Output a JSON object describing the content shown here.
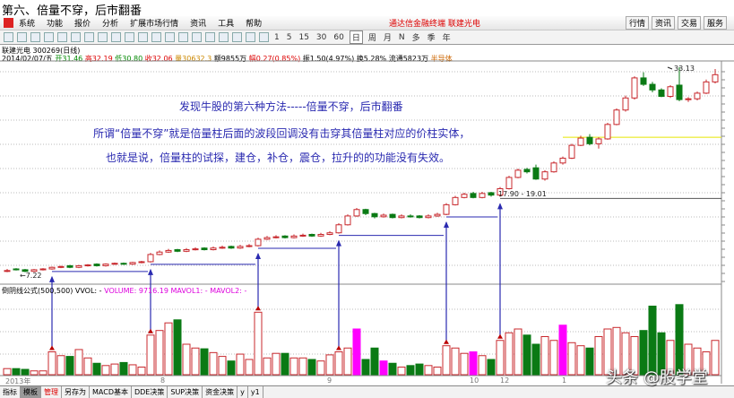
{
  "page_title": "第六、倍量不穿，后市翻番",
  "menu": [
    "系统",
    "功能",
    "报价",
    "分析",
    "扩展市场行情",
    "资讯",
    "工具",
    "帮助"
  ],
  "promo": "通达信金融终端   联建光电",
  "right_buttons": [
    "行情",
    "资讯",
    "交易",
    "服务"
  ],
  "periods": [
    "1",
    "5",
    "15",
    "30",
    "60",
    "日",
    "周",
    "月",
    "N",
    "多",
    "季",
    "年"
  ],
  "stock_title": "联建光电 300269(日线)",
  "quote": {
    "date": "2014/02/07/五",
    "open": "开31.46",
    "high": "高32.19",
    "low": "低30.80",
    "close": "收32.06",
    "vol": "量30632.3",
    "amount": "额9855万",
    "change": "幅0.27(0.85%)",
    "amp": "振1.50(4.97%)",
    "turnover": "换5.28%",
    "float": "流通5823万",
    "sector": "半导体"
  },
  "notes": [
    "发现牛股的第六种方法-----倍量不穿，后市翻番",
    "所谓“倍量不穿”就是倍量柱后面的波段回调没有击穿其倍量柱对应的价柱实体，",
    "也就是说，倍量柱的试探，建仓，补仓，震仓，拉升的的功能没有失效。"
  ],
  "labels": {
    "low": "7.22",
    "high": "33.13",
    "range": "17.90 - 19.01"
  },
  "vol_header": {
    "name": "倒阴线公式(500,500) VVOL: -",
    "volume": "VOLUME: 9716.19",
    "ma": "MAVOL1: - MAVOL2: -"
  },
  "dates": [
    "2013年",
    "8",
    "9",
    "10",
    "12",
    "1"
  ],
  "bottom_tabs": [
    "指标",
    "模板",
    "管理",
    "另存为",
    "MACD基本",
    "DDE决策",
    "SUP决策",
    "资金决策",
    "y",
    "y1"
  ],
  "watermark": "头条 @股学堂",
  "colors": {
    "up": "#c8282d",
    "down": "#0a7a14",
    "special": "#ff00ff",
    "arrow": "#2a2ab0",
    "support": "#e8e800"
  },
  "chart_data": {
    "type": "candlestick",
    "price_range": [
      7.22,
      33.13
    ],
    "ohlc": [
      [
        7.7,
        8.0,
        7.6,
        7.8
      ],
      [
        8.0,
        8.1,
        7.8,
        7.9
      ],
      [
        7.9,
        8.0,
        7.6,
        7.7
      ],
      [
        7.7,
        8.0,
        7.6,
        7.9
      ],
      [
        7.9,
        8.1,
        7.8,
        8.0
      ],
      [
        8.0,
        8.3,
        7.9,
        8.2
      ],
      [
        8.2,
        8.4,
        8.1,
        8.3
      ],
      [
        8.4,
        8.5,
        8.1,
        8.2
      ],
      [
        8.2,
        8.5,
        8.1,
        8.4
      ],
      [
        8.4,
        8.6,
        8.3,
        8.5
      ],
      [
        8.6,
        8.7,
        8.3,
        8.4
      ],
      [
        8.4,
        8.7,
        8.3,
        8.6
      ],
      [
        8.6,
        8.8,
        8.5,
        8.7
      ],
      [
        8.7,
        8.8,
        8.5,
        8.6
      ],
      [
        8.6,
        8.9,
        8.5,
        8.8
      ],
      [
        8.8,
        9.0,
        8.7,
        8.9
      ],
      [
        8.9,
        10.0,
        8.8,
        9.8
      ],
      [
        9.8,
        10.3,
        9.7,
        10.1
      ],
      [
        10.1,
        10.5,
        10.0,
        10.3
      ],
      [
        10.4,
        10.5,
        10.1,
        10.2
      ],
      [
        10.2,
        10.6,
        10.1,
        10.4
      ],
      [
        10.4,
        10.7,
        10.3,
        10.5
      ],
      [
        10.6,
        10.7,
        10.3,
        10.4
      ],
      [
        10.4,
        10.8,
        10.3,
        10.6
      ],
      [
        10.6,
        10.9,
        10.5,
        10.7
      ],
      [
        10.8,
        10.9,
        10.5,
        10.6
      ],
      [
        10.6,
        11.0,
        10.5,
        10.8
      ],
      [
        10.8,
        11.1,
        10.7,
        10.9
      ],
      [
        10.9,
        11.9,
        10.8,
        11.7
      ],
      [
        11.7,
        12.1,
        11.6,
        11.9
      ],
      [
        11.9,
        12.2,
        11.8,
        12.0
      ],
      [
        12.1,
        12.2,
        11.8,
        11.9
      ],
      [
        11.9,
        12.3,
        11.8,
        12.1
      ],
      [
        12.1,
        12.4,
        12.0,
        12.2
      ],
      [
        12.3,
        12.4,
        12.0,
        12.1
      ],
      [
        12.1,
        12.5,
        12.0,
        12.3
      ],
      [
        12.3,
        12.7,
        12.2,
        12.5
      ],
      [
        12.5,
        13.7,
        12.4,
        13.5
      ],
      [
        13.5,
        14.8,
        13.4,
        14.6
      ],
      [
        14.6,
        15.6,
        14.5,
        15.4
      ],
      [
        15.4,
        15.5,
        14.7,
        14.9
      ],
      [
        14.9,
        15.0,
        14.3,
        14.5
      ],
      [
        14.5,
        14.9,
        14.4,
        14.7
      ],
      [
        14.8,
        14.9,
        14.3,
        14.4
      ],
      [
        14.4,
        14.8,
        14.3,
        14.6
      ],
      [
        14.6,
        14.8,
        14.4,
        14.5
      ],
      [
        14.6,
        14.7,
        14.3,
        14.4
      ],
      [
        14.4,
        14.8,
        14.3,
        14.6
      ],
      [
        14.6,
        15.0,
        14.5,
        14.8
      ],
      [
        14.8,
        16.2,
        14.7,
        16.0
      ],
      [
        16.0,
        17.1,
        15.9,
        16.9
      ],
      [
        16.9,
        17.5,
        16.8,
        17.3
      ],
      [
        17.4,
        17.6,
        16.8,
        16.9
      ],
      [
        16.9,
        17.6,
        16.8,
        17.4
      ],
      [
        17.5,
        17.6,
        17.0,
        17.2
      ],
      [
        17.2,
        18.2,
        17.0,
        18.0
      ],
      [
        18.0,
        19.6,
        17.9,
        19.4
      ],
      [
        19.4,
        20.5,
        19.3,
        20.3
      ],
      [
        20.4,
        20.6,
        19.9,
        20.1
      ],
      [
        20.6,
        21.0,
        19.1,
        19.2
      ],
      [
        19.2,
        20.3,
        19.0,
        20.1
      ],
      [
        20.1,
        21.4,
        20.0,
        21.2
      ],
      [
        21.2,
        22.0,
        21.0,
        21.8
      ],
      [
        21.8,
        23.6,
        21.7,
        23.4
      ],
      [
        23.4,
        24.6,
        23.3,
        24.3
      ],
      [
        24.4,
        24.8,
        23.4,
        23.6
      ],
      [
        23.6,
        24.4,
        23.0,
        24.2
      ],
      [
        24.2,
        26.2,
        24.1,
        26.0
      ],
      [
        26.0,
        28.0,
        25.9,
        27.8
      ],
      [
        27.8,
        29.6,
        27.6,
        29.3
      ],
      [
        29.3,
        32.0,
        29.1,
        31.8
      ],
      [
        31.8,
        32.5,
        30.8,
        31.0
      ],
      [
        31.0,
        31.3,
        30.0,
        30.3
      ],
      [
        30.3,
        30.5,
        29.4,
        29.5
      ],
      [
        29.5,
        30.9,
        29.3,
        30.7
      ],
      [
        30.9,
        33.13,
        28.9,
        29.1
      ],
      [
        29.1,
        29.4,
        28.8,
        29.2
      ],
      [
        29.2,
        30.1,
        29.0,
        29.9
      ],
      [
        29.9,
        31.6,
        29.8,
        31.3
      ],
      [
        31.3,
        32.9,
        31.1,
        32.2
      ]
    ],
    "volume": [
      8,
      8,
      7,
      5,
      5,
      30,
      25,
      24,
      33,
      22,
      15,
      12,
      14,
      16,
      13,
      10,
      52,
      58,
      68,
      72,
      40,
      35,
      34,
      29,
      24,
      18,
      27,
      20,
      82,
      22,
      28,
      28,
      22,
      22,
      20,
      18,
      26,
      30,
      35,
      60,
      20,
      35,
      18,
      15,
      10,
      12,
      14,
      12,
      10,
      38,
      35,
      28,
      30,
      25,
      20,
      45,
      55,
      60,
      52,
      40,
      50,
      45,
      65,
      42,
      38,
      35,
      50,
      60,
      62,
      55,
      50,
      58,
      90,
      55,
      45,
      92,
      40,
      35,
      30,
      45
    ],
    "special_volume_bars": [
      39,
      42,
      52,
      62
    ],
    "double_volume_bars": [
      5,
      16,
      28,
      37,
      49,
      55
    ],
    "support_level": 24.4
  }
}
